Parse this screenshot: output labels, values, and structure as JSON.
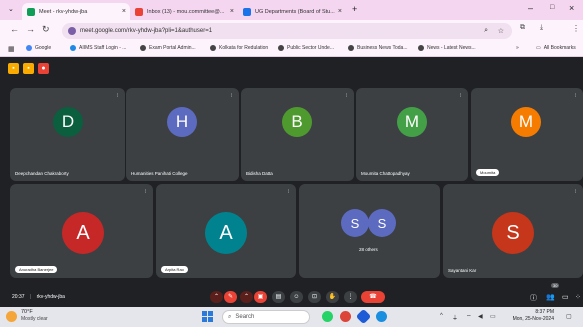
{
  "browser": {
    "tabs": [
      {
        "label": "Meet - rkv-yhdw-jba",
        "active": true,
        "favicon_color": "#0f9d58"
      },
      {
        "label": "Inbox (13) - mou.committee@...",
        "active": false,
        "favicon_color": "#ea4335"
      },
      {
        "label": "UG Departments (Board of Stu...",
        "active": false,
        "favicon_color": "#1a73e8"
      }
    ],
    "new_tab": "+",
    "close_glyph": "×",
    "address": "meet.google.com/rkv-yhdw-jba?pli=1&authuser=1",
    "bookmarks": [
      "Google",
      "AIIMS Staff Login - ...",
      "Exam Portal Admin...",
      "Kolkata for Redulation",
      "Public Sector Unde...",
      "Business News Toda...",
      "News - Latest News..."
    ],
    "all_bookmarks": "All Bookmarks"
  },
  "participants": [
    {
      "initial": "D",
      "name": "Deepchandan Chakraborty",
      "color": "#0b5e3e",
      "label_style": "text"
    },
    {
      "initial": "H",
      "name": "Humanities Panihati College",
      "color": "#5c6bc0",
      "label_style": "text"
    },
    {
      "initial": "B",
      "name": "Bidisha Datta",
      "color": "#4f9a2f",
      "label_style": "text"
    },
    {
      "initial": "M",
      "name": "Moumita Chattopadhyay",
      "color": "#43a047",
      "label_style": "text"
    },
    {
      "initial": "M",
      "name": "Moumita",
      "color": "#f57c00",
      "label_style": "pill"
    },
    {
      "initial": "A",
      "name": "Anuradha Banerjee",
      "color": "#c62828",
      "label_style": "pill"
    },
    {
      "initial": "A",
      "name": "Arpita Rao",
      "color": "#00838f",
      "label_style": "pill"
    },
    {
      "initial": "S",
      "name": "Sayantani Kar",
      "color": "#c6361b",
      "label_style": "text"
    }
  ],
  "others_tile": {
    "initials": [
      "S",
      "S"
    ],
    "label": "28 others",
    "color": "#5c6bc0"
  },
  "bottom_bar": {
    "time": "20:37",
    "meeting_code": "rkv-yhdw-jba",
    "participant_badge": "30"
  },
  "taskbar": {
    "temperature": "70°F",
    "weather": "Mostly clear",
    "search_placeholder": "Search",
    "time": "8:37 PM",
    "date": "Mon, 25-Nov-2024",
    "language": "ENG IN"
  }
}
